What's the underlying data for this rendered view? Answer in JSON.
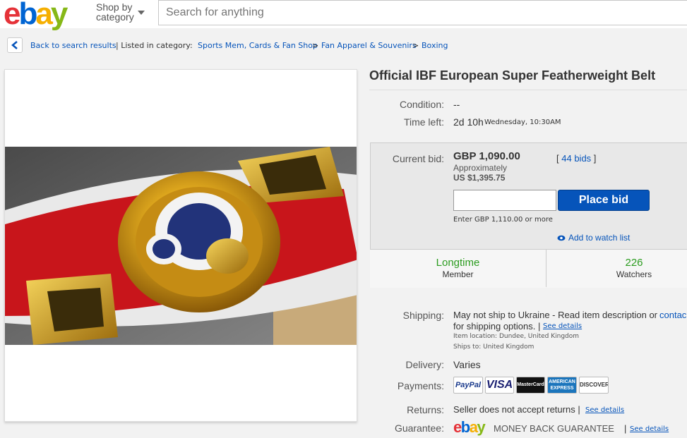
{
  "header": {
    "logo_letters": [
      "e",
      "b",
      "a",
      "y"
    ],
    "logo_colors": [
      "#e53238",
      "#0064d2",
      "#f5af02",
      "#86b817"
    ],
    "shop_by_line1": "Shop by",
    "shop_by_line2": "category",
    "search_placeholder": "Search for anything"
  },
  "breadcrumb": {
    "back": "Back to search results",
    "listed_in": "| Listed in category:",
    "cat1": "Sports Mem, Cards & Fan Shop",
    "cat2": "Fan Apparel & Souvenirs",
    "cat3": "Boxing",
    "sep": ">"
  },
  "item": {
    "title": "Official IBF European Super Featherweight Belt",
    "condition_label": "Condition:",
    "condition_value": "--",
    "time_left_label": "Time left:",
    "time_left_value": "2d 10h",
    "time_left_end": "Wednesday, 10:30AM"
  },
  "bid": {
    "current_bid_label": "Current bid:",
    "current_bid": "GBP 1,090.00",
    "approx_label": "Approximately",
    "approx_value": "US $1,395.75",
    "bids_open": "[",
    "bids_link": "44 bids",
    "bids_close": "]",
    "input_value": "",
    "place_bid": "Place bid",
    "enter_hint": "Enter GBP 1,110.00 or more",
    "watch_link": "Add to watch list"
  },
  "stats": {
    "left_top": "Longtime",
    "left_bottom": "Member",
    "right_top": "226",
    "right_bottom": "Watchers"
  },
  "shipping": {
    "label": "Shipping:",
    "line1": "May not ship to Ukraine - Read item description or",
    "contact": "contac",
    "line2": "for shipping options. |",
    "see_details": "See details",
    "location": "Item location:  Dundee, United Kingdom",
    "ships_to": "Ships to:  United Kingdom"
  },
  "delivery": {
    "label": "Delivery:",
    "value": "Varies"
  },
  "payments": {
    "label": "Payments:",
    "cards": [
      "PayPal",
      "VISA",
      "MasterCard",
      "AMERICAN EXPRESS",
      "DISCOVER"
    ]
  },
  "returns": {
    "label": "Returns:",
    "value": "Seller does not accept returns |",
    "see_details": "See details"
  },
  "guarantee": {
    "label": "Guarantee:",
    "text": "MONEY BACK GUARANTEE",
    "sep": "|",
    "see_details": "See details"
  }
}
